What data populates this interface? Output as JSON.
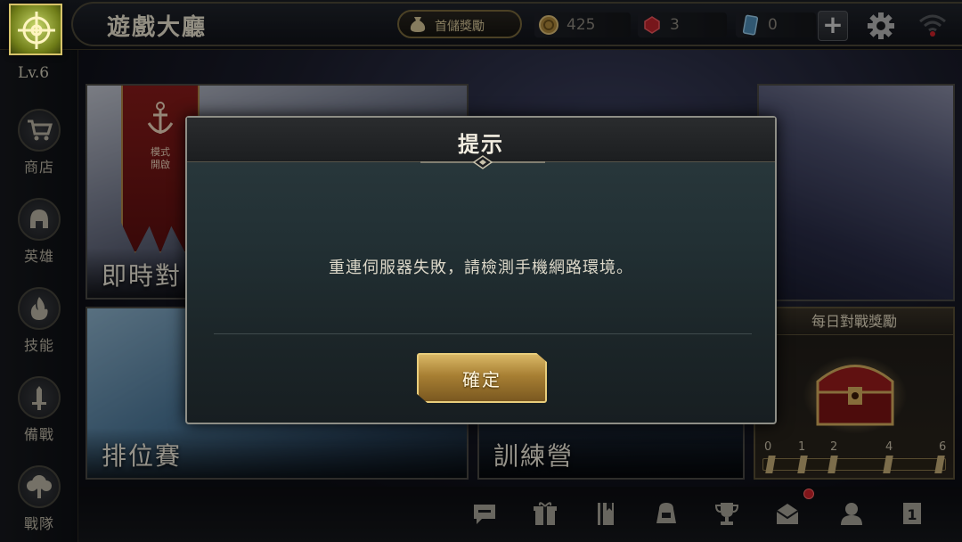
{
  "header": {
    "title": "遊戲大廳",
    "first_charge_label": "首儲獎勵",
    "currencies": [
      {
        "name": "gold-coin",
        "value": "425"
      },
      {
        "name": "red-gem",
        "value": "3"
      },
      {
        "name": "voucher-card",
        "value": "0"
      }
    ],
    "add_label": "+"
  },
  "sidebar": {
    "level": "Lv.6",
    "items": [
      {
        "label": "商店",
        "icon": "shop-cart-icon"
      },
      {
        "label": "英雄",
        "icon": "hero-helmet-icon"
      },
      {
        "label": "技能",
        "icon": "skill-flame-icon"
      },
      {
        "label": "備戰",
        "icon": "prepare-sword-icon"
      },
      {
        "label": "戰隊",
        "icon": "team-tree-icon"
      }
    ]
  },
  "modes": {
    "realtime": "即時對",
    "mode_banner": "模式\n開啟",
    "ranked": "排位賽",
    "training": "訓練營"
  },
  "daily_reward": {
    "title": "每日對戰獎勵",
    "ticks": [
      "0",
      "1",
      "2",
      "4",
      "6"
    ]
  },
  "dialog": {
    "title": "提示",
    "message": "重連伺服器失敗，請檢測手機網路環境。",
    "confirm_label": "確定"
  },
  "bottom_toolbar": [
    "chat-icon",
    "gift-icon",
    "book-icon",
    "backpack-icon",
    "trophy-icon",
    "mail-icon",
    "friends-icon",
    "ranking-icon"
  ],
  "colors": {
    "accent_gold": "#d9b765",
    "notification_red": "#d0232a"
  }
}
